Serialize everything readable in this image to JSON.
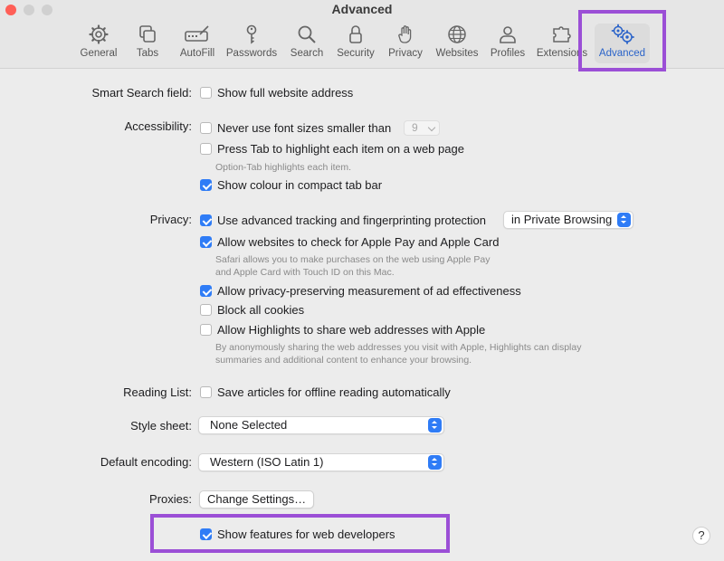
{
  "window": {
    "title": "Advanced"
  },
  "toolbar": {
    "tabs": [
      {
        "label": "General",
        "icon": "gear-icon"
      },
      {
        "label": "Tabs",
        "icon": "tabs-icon"
      },
      {
        "label": "AutoFill",
        "icon": "autofill-icon"
      },
      {
        "label": "Passwords",
        "icon": "key-icon"
      },
      {
        "label": "Search",
        "icon": "search-icon"
      },
      {
        "label": "Security",
        "icon": "lock-icon"
      },
      {
        "label": "Privacy",
        "icon": "hand-icon"
      },
      {
        "label": "Websites",
        "icon": "globe-icon"
      },
      {
        "label": "Profiles",
        "icon": "person-icon"
      },
      {
        "label": "Extensions",
        "icon": "puzzle-icon"
      },
      {
        "label": "Advanced",
        "icon": "gears-icon",
        "active": true
      }
    ]
  },
  "settings": {
    "smart_search": {
      "label": "Smart Search field:",
      "option": "Show full website address",
      "checked": false
    },
    "accessibility": {
      "label": "Accessibility:",
      "min_font": {
        "text": "Never use font sizes smaller than",
        "checked": false,
        "value": "9"
      },
      "press_tab": {
        "text": "Press Tab to highlight each item on a web page",
        "checked": false,
        "note": "Option-Tab highlights each item."
      },
      "show_colour": {
        "text": "Show colour in compact tab bar",
        "checked": true
      }
    },
    "privacy": {
      "label": "Privacy:",
      "tracking": {
        "text": "Use advanced tracking and fingerprinting protection",
        "checked": true,
        "select_value": "in Private Browsing"
      },
      "apple_pay": {
        "text": "Allow websites to check for Apple Pay and Apple Card",
        "checked": true,
        "note_line1": "Safari allows you to make purchases on the web using Apple Pay",
        "note_line2": "and Apple Card with Touch ID on this Mac."
      },
      "ad_measurement": {
        "text": "Allow privacy-preserving measurement of ad effectiveness",
        "checked": true
      },
      "block_cookies": {
        "text": "Block all cookies",
        "checked": false
      },
      "highlights": {
        "text": "Allow Highlights to share web addresses with Apple",
        "checked": false,
        "note_line1": "By anonymously sharing the web addresses you visit with Apple, Highlights can display",
        "note_line2": "summaries and additional content to enhance your browsing."
      }
    },
    "reading_list": {
      "label": "Reading List:",
      "text": "Save articles for offline reading automatically",
      "checked": false
    },
    "style_sheet": {
      "label": "Style sheet:",
      "value": "None Selected"
    },
    "encoding": {
      "label": "Default encoding:",
      "value": "Western (ISO Latin 1)"
    },
    "proxies": {
      "label": "Proxies:",
      "button": "Change Settings…"
    },
    "developer": {
      "text": "Show features for web developers",
      "checked": true
    }
  },
  "help": {
    "label": "?"
  },
  "colors": {
    "accent": "#2f7cf6",
    "highlight": "#9b4fd6"
  }
}
